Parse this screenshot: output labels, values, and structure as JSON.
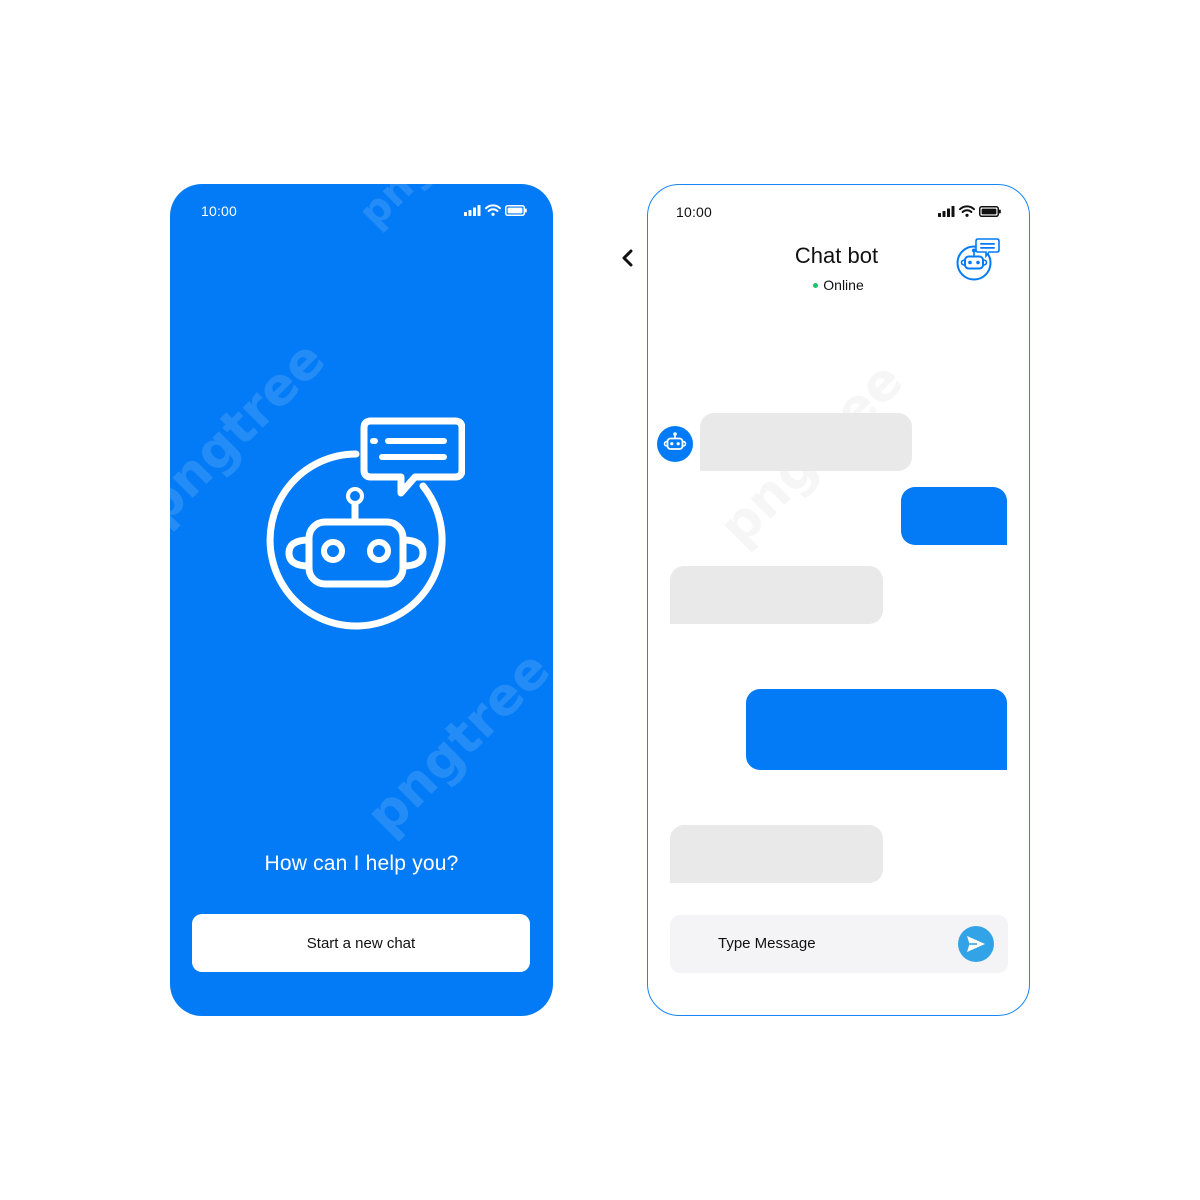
{
  "colors": {
    "brand_blue": "#047bf6",
    "bot_bubble": "#e9e9e9",
    "online": "#1fc06c",
    "send_button": "#33a3e8"
  },
  "welcome_screen": {
    "status_time": "10:00",
    "icons": [
      "signal-icon",
      "wifi-icon",
      "battery-icon",
      "chatbot-icon"
    ],
    "prompt": "How can I help you?",
    "start_button_label": "Start a new chat"
  },
  "chat_screen": {
    "status_time": "10:00",
    "icons": [
      "signal-icon",
      "wifi-icon",
      "battery-icon",
      "back-chevron-icon",
      "chatbot-icon",
      "send-icon"
    ],
    "title": "Chat bot",
    "status": "Online",
    "messages": [
      {
        "sender": "bot",
        "text": ""
      },
      {
        "sender": "user",
        "text": ""
      },
      {
        "sender": "bot",
        "text": ""
      },
      {
        "sender": "user",
        "text": ""
      },
      {
        "sender": "bot",
        "text": ""
      }
    ],
    "input_placeholder": "Type Message"
  },
  "watermark": "pngtree"
}
